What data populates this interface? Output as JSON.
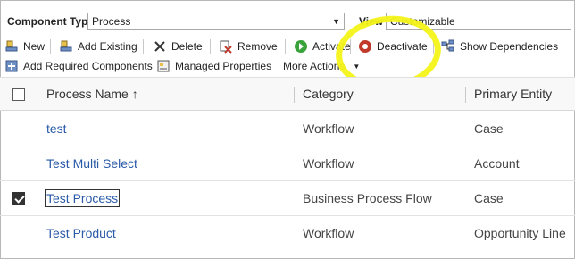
{
  "filter": {
    "component_type_label": "Component Type",
    "component_type_value": "Process",
    "view_label": "View",
    "view_value": "Customizable"
  },
  "toolbar": {
    "new": "New",
    "add_existing": "Add Existing",
    "delete": "Delete",
    "remove": "Remove",
    "activate": "Activate",
    "deactivate": "Deactivate",
    "show_dependencies": "Show Dependencies",
    "add_required": "Add Required Components",
    "managed_properties": "Managed Properties",
    "more_actions": "More Actions"
  },
  "grid": {
    "columns": [
      "Process Name ↑",
      "Category",
      "Primary Entity"
    ],
    "rows": [
      {
        "name": "test",
        "category": "Workflow",
        "entity": "Case",
        "checked": false
      },
      {
        "name": "Test Multi Select",
        "category": "Workflow",
        "entity": "Account",
        "checked": false
      },
      {
        "name": "Test Process",
        "category": "Business Process Flow",
        "entity": "Case",
        "checked": true
      },
      {
        "name": "Test Product",
        "category": "Workflow",
        "entity": "Opportunity Line",
        "checked": false
      }
    ]
  },
  "colors": {
    "link": "#2a5aa8",
    "highlight": "#f4f41a",
    "activate_icon": "#3aa23a",
    "deactivate_icon": "#c0392b"
  }
}
